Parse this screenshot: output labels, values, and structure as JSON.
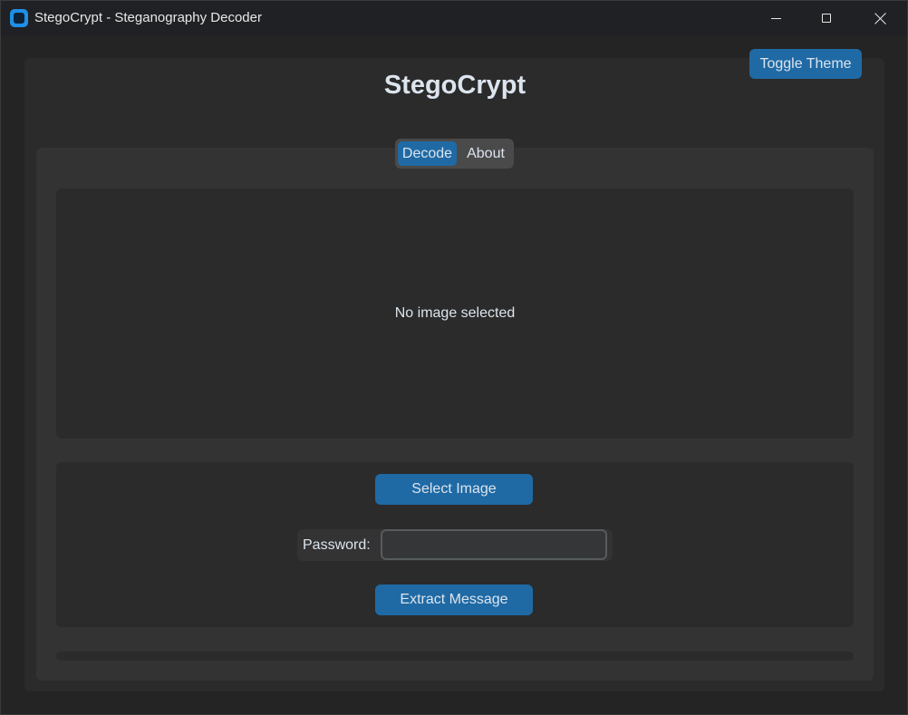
{
  "window": {
    "title": "StegoCrypt - Steganography Decoder",
    "icon": "app-icon"
  },
  "header": {
    "app_title": "StegoCrypt",
    "toggle_theme_label": "Toggle Theme"
  },
  "tabs": [
    {
      "label": "Decode",
      "selected": true
    },
    {
      "label": "About",
      "selected": false
    }
  ],
  "decode": {
    "image_placeholder": "No image selected",
    "select_image_label": "Select Image",
    "password_label": "Password:",
    "password_value": "",
    "extract_label": "Extract Message",
    "progress": 0
  },
  "colors": {
    "accent": "#1f6aa5",
    "background": "#242424",
    "frame": "#2b2b2b",
    "tabview": "#333333",
    "text": "#dce4ee"
  }
}
